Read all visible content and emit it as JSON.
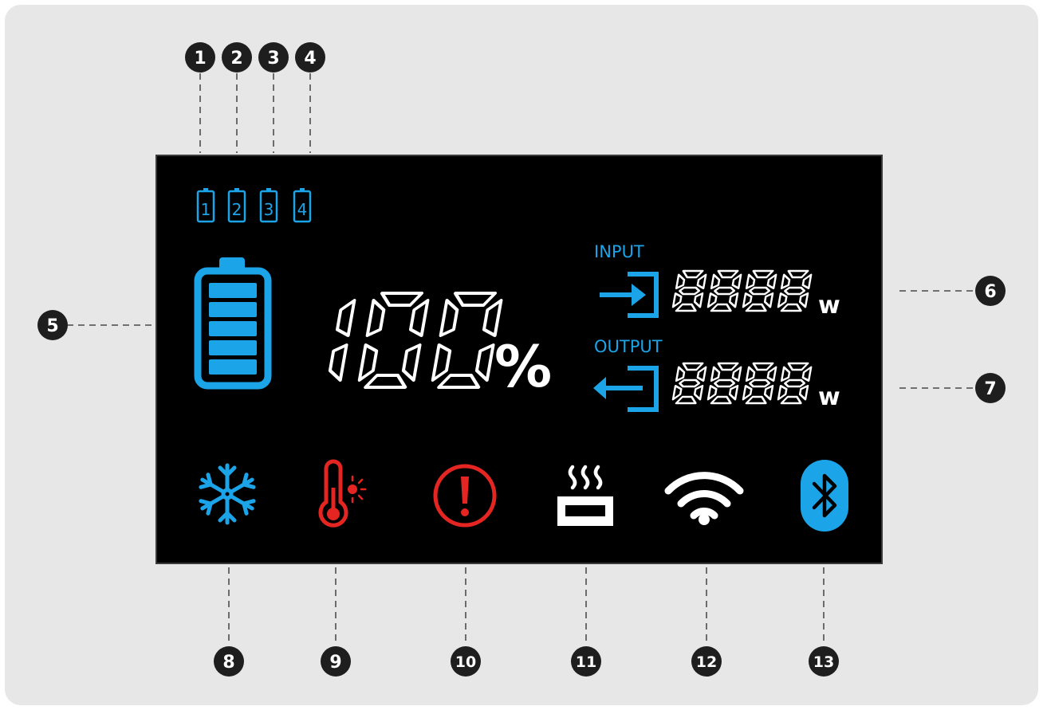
{
  "colors": {
    "background": "#e7e7e8",
    "screen": "#000000",
    "accent_blue": "#1ca4e8",
    "alert_red": "#e52521",
    "white": "#ffffff",
    "badge": "#1e1e1e"
  },
  "callouts": [
    "1",
    "2",
    "3",
    "4",
    "5",
    "6",
    "7",
    "8",
    "9",
    "10",
    "11",
    "12",
    "13"
  ],
  "battery_packs": [
    {
      "label": "1"
    },
    {
      "label": "2"
    },
    {
      "label": "3"
    },
    {
      "label": "4"
    }
  ],
  "main_battery": {
    "level": 1.0,
    "bars": 5
  },
  "percent": {
    "value": "100",
    "symbol": "%"
  },
  "input": {
    "label": "INPUT",
    "value": "8888",
    "unit": "w"
  },
  "output": {
    "label": "OUTPUT",
    "value": "8888",
    "unit": "w"
  },
  "status_icons": [
    {
      "name": "snowflake-icon",
      "color": "#1ca4e8"
    },
    {
      "name": "high-temperature-icon",
      "color": "#e52521"
    },
    {
      "name": "warning-icon",
      "color": "#e52521"
    },
    {
      "name": "heating-icon",
      "color": "#ffffff"
    },
    {
      "name": "wifi-icon",
      "color": "#ffffff"
    },
    {
      "name": "bluetooth-icon",
      "color": "#1ca4e8"
    }
  ]
}
